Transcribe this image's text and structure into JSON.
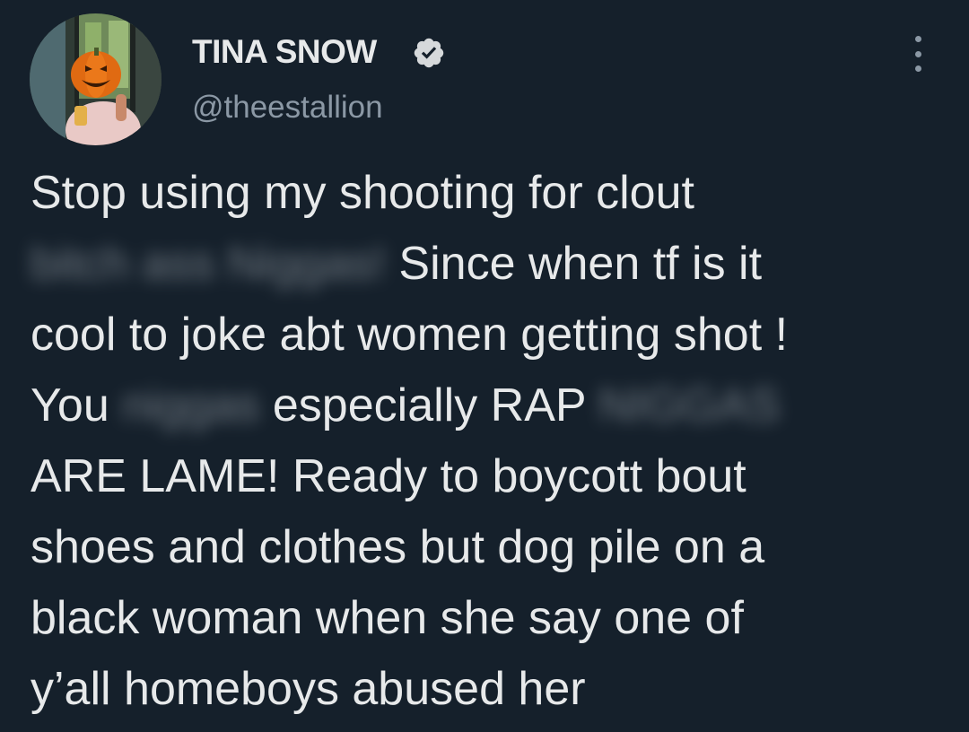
{
  "author": {
    "display_name": "TINA SNOW",
    "handle": "@theestallion",
    "verified_icon": "verified-badge-icon",
    "avatar_icon": "pumpkin-head-avatar"
  },
  "menu": {
    "icon": "more-options-icon"
  },
  "tweet": {
    "line1": "Stop using my shooting for clout",
    "line2_censored": "bitch ass Niggas!",
    "line2_rest": " Since when tf is it",
    "line3": "cool to joke abt women getting shot !",
    "line4_a": "You ",
    "line4_censored_1": "niggas",
    "line4_b": " especially RAP ",
    "line4_censored_2": "NIGGAS",
    "line5": "ARE LAME! Ready to boycott bout",
    "line6": "shoes and clothes but dog pile on a",
    "line7": "black woman when she say one of",
    "line8": "y’all homeboys abused her"
  },
  "colors": {
    "background": "#15202b",
    "text_primary": "#e7e9ea",
    "text_secondary": "#8b98a5"
  }
}
